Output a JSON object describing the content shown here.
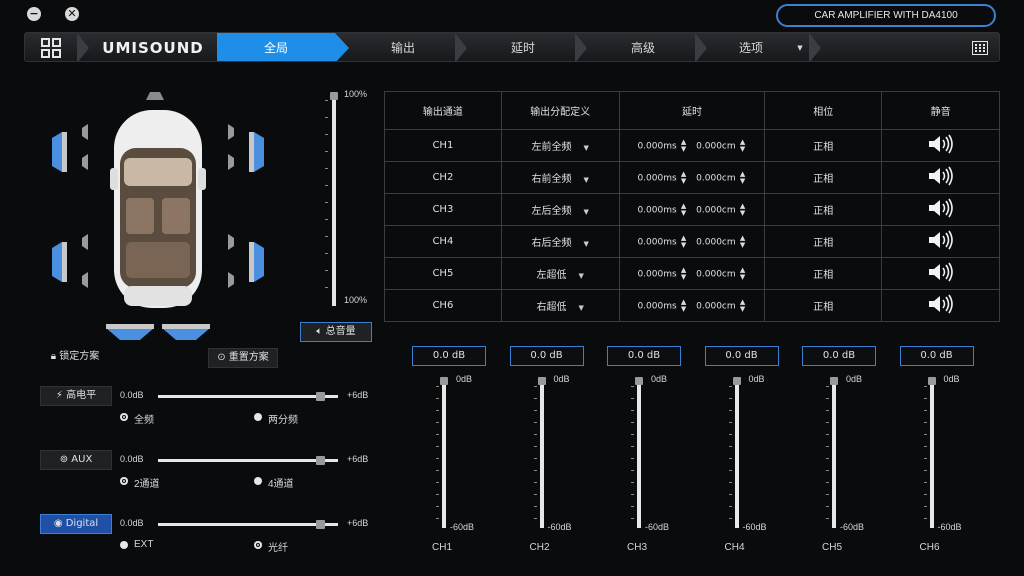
{
  "window": {
    "minimize_symbol": "−",
    "close_symbol": "✕"
  },
  "model_badge": "CAR AMPLIFIER WITH DA4100",
  "nav": {
    "brand": "UMISOUND",
    "tabs": [
      "全局",
      "输出",
      "延时",
      "高级",
      "选项"
    ],
    "active_tab": "全局"
  },
  "master_volume": {
    "top_label": "100%",
    "bottom_label": "100%",
    "value_percent": 100,
    "button_label": "总音量"
  },
  "table": {
    "headers": [
      "输出通道",
      "输出分配定义",
      "延时",
      "相位",
      "静音"
    ],
    "rows": [
      {
        "ch": "CH1",
        "assign": "左前全频",
        "delay_ms": "0.000ms",
        "delay_cm": "0.000cm",
        "phase": "正相"
      },
      {
        "ch": "CH2",
        "assign": "右前全频",
        "delay_ms": "0.000ms",
        "delay_cm": "0.000cm",
        "phase": "正相"
      },
      {
        "ch": "CH3",
        "assign": "左后全频",
        "delay_ms": "0.000ms",
        "delay_cm": "0.000cm",
        "phase": "正相"
      },
      {
        "ch": "CH4",
        "assign": "右后全频",
        "delay_ms": "0.000ms",
        "delay_cm": "0.000cm",
        "phase": "正相"
      },
      {
        "ch": "CH5",
        "assign": "左超低",
        "delay_ms": "0.000ms",
        "delay_cm": "0.000cm",
        "phase": "正相"
      },
      {
        "ch": "CH6",
        "assign": "右超低",
        "delay_ms": "0.000ms",
        "delay_cm": "0.000cm",
        "phase": "正相"
      }
    ]
  },
  "channels": [
    {
      "name": "CH1",
      "gain": "0.0 dB",
      "top": "0dB",
      "bottom": "-60dB"
    },
    {
      "name": "CH2",
      "gain": "0.0 dB",
      "top": "0dB",
      "bottom": "-60dB"
    },
    {
      "name": "CH3",
      "gain": "0.0 dB",
      "top": "0dB",
      "bottom": "-60dB"
    },
    {
      "name": "CH4",
      "gain": "0.0 dB",
      "top": "0dB",
      "bottom": "-60dB"
    },
    {
      "name": "CH5",
      "gain": "0.0 dB",
      "top": "0dB",
      "bottom": "-60dB"
    },
    {
      "name": "CH6",
      "gain": "0.0 dB",
      "top": "0dB",
      "bottom": "-60dB"
    }
  ],
  "presets": {
    "lock": "锁定方案",
    "reset": "重置方案"
  },
  "inputs": [
    {
      "label": "高电平",
      "min": "0.0dB",
      "max": "+6dB",
      "opt1": "全频",
      "opt2": "两分频",
      "selected": 1,
      "active": false
    },
    {
      "label": "AUX",
      "min": "0.0dB",
      "max": "+6dB",
      "opt1": "2通道",
      "opt2": "4通道",
      "selected": 1,
      "active": false
    },
    {
      "label": "Digital",
      "min": "0.0dB",
      "max": "+6dB",
      "opt1": "EXT",
      "opt2": "光纤",
      "selected": 2,
      "active": true
    }
  ],
  "colors": {
    "accent": "#1e8ee8",
    "border_blue": "#3d7fd1",
    "speaker_blue": "#4a8fe0"
  }
}
